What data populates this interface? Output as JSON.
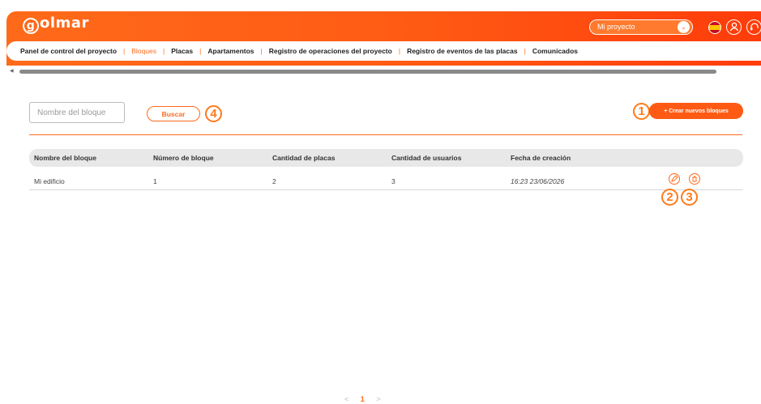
{
  "header": {
    "logo_text": "olmar",
    "logo_letter": "g",
    "project_select": {
      "value": "Mi proyecto",
      "chevron": "⌄"
    },
    "user_icon": "user-icon",
    "help_icon": "headset-icon"
  },
  "nav": {
    "items": [
      {
        "label": "Panel de control del proyecto"
      },
      {
        "label": "Bloques"
      },
      {
        "label": "Placas"
      },
      {
        "label": "Apartamentos"
      },
      {
        "label": "Registro de operaciones del proyecto"
      },
      {
        "label": "Registro de eventos de las placas"
      },
      {
        "label": "Comunicados"
      }
    ],
    "separator": "|"
  },
  "search": {
    "placeholder": "Nombre del bloque",
    "button_label": "Buscar"
  },
  "actions": {
    "create_label": "+ Crear nuevos bloques"
  },
  "callouts": [
    "1",
    "2",
    "3",
    "4"
  ],
  "table": {
    "headers": [
      "Nombre del bloque",
      "Número de bloque",
      "Cantidad de placas",
      "Cantidad de usuarios",
      "Fecha de creación"
    ],
    "rows": [
      {
        "cells": [
          "Mi edificio",
          "1",
          "2",
          "3",
          "16:23 23/06/2026"
        ]
      }
    ]
  },
  "pagination": {
    "prev": "<",
    "current": "1",
    "next": ">"
  },
  "colors": {
    "accent": "#ff6a1a",
    "header_gradient_end": "#ff3c0a"
  }
}
